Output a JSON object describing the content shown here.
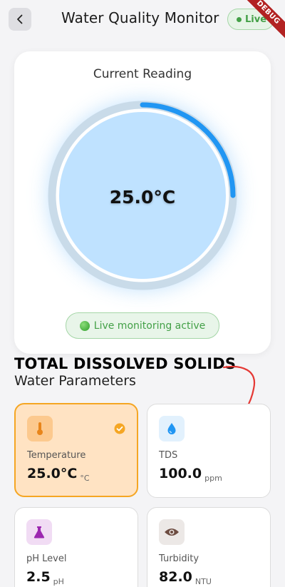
{
  "header": {
    "title": "Water Quality Monitor",
    "live_label": "Live",
    "debug_label": "DEBUG"
  },
  "reading": {
    "title": "Current Reading",
    "value": "25.0°C",
    "progress_fraction": 0.25,
    "status": "Live monitoring active"
  },
  "annotation": {
    "text": "TOTAL DISSOLVED SOLIDS"
  },
  "parameters": {
    "title": "Water Parameters",
    "items": [
      {
        "label": "Temperature",
        "value": "25.0°C",
        "unit": "°C",
        "icon": "thermometer-icon",
        "selected": true
      },
      {
        "label": "TDS",
        "value": "100.0",
        "unit": "ppm",
        "icon": "water-drop-icon",
        "selected": false
      },
      {
        "label": "pH Level",
        "value": "2.5",
        "unit": "pH",
        "icon": "flask-icon",
        "selected": false
      },
      {
        "label": "Turbidity",
        "value": "82.0",
        "unit": "NTU",
        "icon": "eye-icon",
        "selected": false
      }
    ]
  },
  "colors": {
    "accent": "#2196f3",
    "selected_border": "#f5a623",
    "live_green": "#43a047",
    "annotation_red": "#e53935"
  }
}
